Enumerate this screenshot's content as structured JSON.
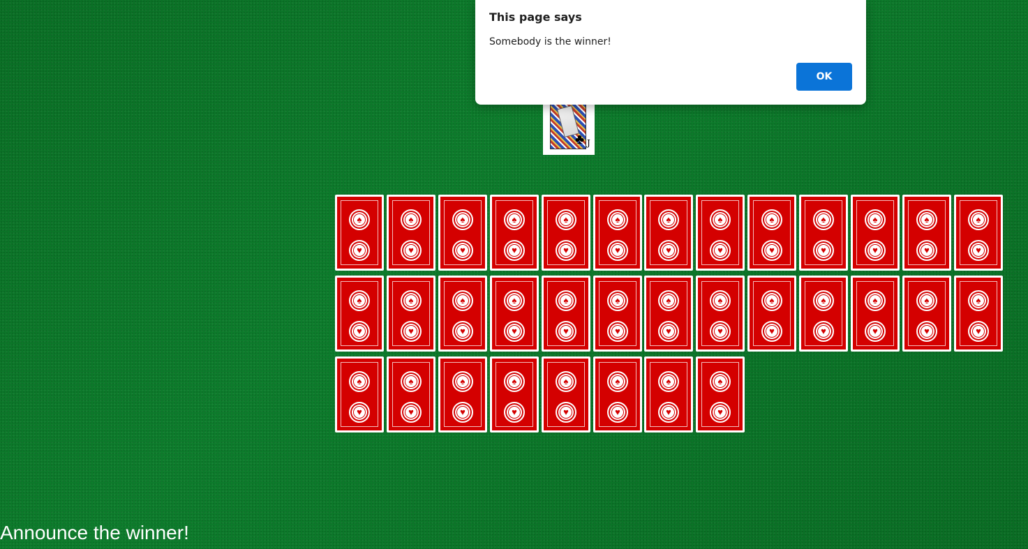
{
  "table": {
    "background_color": "#0c7a2a",
    "face_up_card": {
      "name": "jack-of-clubs",
      "suit_symbol": "♣",
      "rank_symbol": "J"
    },
    "card_back_color": "#d40000",
    "card_back_emblems": [
      "♠",
      "♥"
    ],
    "face_down_card_rows": [
      13,
      13,
      8
    ]
  },
  "announcement": {
    "text": "Announce the winner!"
  },
  "alert": {
    "title": "This page says",
    "message": "Somebody is the winner!",
    "ok_label": "OK",
    "ok_color": "#0b74d8"
  }
}
